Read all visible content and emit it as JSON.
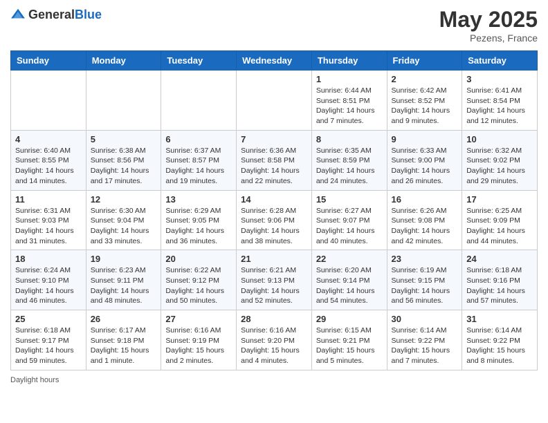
{
  "header": {
    "logo_general": "General",
    "logo_blue": "Blue",
    "month_title": "May 2025",
    "location": "Pezens, France"
  },
  "weekdays": [
    "Sunday",
    "Monday",
    "Tuesday",
    "Wednesday",
    "Thursday",
    "Friday",
    "Saturday"
  ],
  "legend": {
    "daylight_label": "Daylight hours"
  },
  "weeks": [
    [
      {
        "day": "",
        "sunrise": "",
        "sunset": "",
        "daylight": ""
      },
      {
        "day": "",
        "sunrise": "",
        "sunset": "",
        "daylight": ""
      },
      {
        "day": "",
        "sunrise": "",
        "sunset": "",
        "daylight": ""
      },
      {
        "day": "",
        "sunrise": "",
        "sunset": "",
        "daylight": ""
      },
      {
        "day": "1",
        "sunrise": "6:44 AM",
        "sunset": "8:51 PM",
        "daylight": "14 hours and 7 minutes."
      },
      {
        "day": "2",
        "sunrise": "6:42 AM",
        "sunset": "8:52 PM",
        "daylight": "14 hours and 9 minutes."
      },
      {
        "day": "3",
        "sunrise": "6:41 AM",
        "sunset": "8:54 PM",
        "daylight": "14 hours and 12 minutes."
      }
    ],
    [
      {
        "day": "4",
        "sunrise": "6:40 AM",
        "sunset": "8:55 PM",
        "daylight": "14 hours and 14 minutes."
      },
      {
        "day": "5",
        "sunrise": "6:38 AM",
        "sunset": "8:56 PM",
        "daylight": "14 hours and 17 minutes."
      },
      {
        "day": "6",
        "sunrise": "6:37 AM",
        "sunset": "8:57 PM",
        "daylight": "14 hours and 19 minutes."
      },
      {
        "day": "7",
        "sunrise": "6:36 AM",
        "sunset": "8:58 PM",
        "daylight": "14 hours and 22 minutes."
      },
      {
        "day": "8",
        "sunrise": "6:35 AM",
        "sunset": "8:59 PM",
        "daylight": "14 hours and 24 minutes."
      },
      {
        "day": "9",
        "sunrise": "6:33 AM",
        "sunset": "9:00 PM",
        "daylight": "14 hours and 26 minutes."
      },
      {
        "day": "10",
        "sunrise": "6:32 AM",
        "sunset": "9:02 PM",
        "daylight": "14 hours and 29 minutes."
      }
    ],
    [
      {
        "day": "11",
        "sunrise": "6:31 AM",
        "sunset": "9:03 PM",
        "daylight": "14 hours and 31 minutes."
      },
      {
        "day": "12",
        "sunrise": "6:30 AM",
        "sunset": "9:04 PM",
        "daylight": "14 hours and 33 minutes."
      },
      {
        "day": "13",
        "sunrise": "6:29 AM",
        "sunset": "9:05 PM",
        "daylight": "14 hours and 36 minutes."
      },
      {
        "day": "14",
        "sunrise": "6:28 AM",
        "sunset": "9:06 PM",
        "daylight": "14 hours and 38 minutes."
      },
      {
        "day": "15",
        "sunrise": "6:27 AM",
        "sunset": "9:07 PM",
        "daylight": "14 hours and 40 minutes."
      },
      {
        "day": "16",
        "sunrise": "6:26 AM",
        "sunset": "9:08 PM",
        "daylight": "14 hours and 42 minutes."
      },
      {
        "day": "17",
        "sunrise": "6:25 AM",
        "sunset": "9:09 PM",
        "daylight": "14 hours and 44 minutes."
      }
    ],
    [
      {
        "day": "18",
        "sunrise": "6:24 AM",
        "sunset": "9:10 PM",
        "daylight": "14 hours and 46 minutes."
      },
      {
        "day": "19",
        "sunrise": "6:23 AM",
        "sunset": "9:11 PM",
        "daylight": "14 hours and 48 minutes."
      },
      {
        "day": "20",
        "sunrise": "6:22 AM",
        "sunset": "9:12 PM",
        "daylight": "14 hours and 50 minutes."
      },
      {
        "day": "21",
        "sunrise": "6:21 AM",
        "sunset": "9:13 PM",
        "daylight": "14 hours and 52 minutes."
      },
      {
        "day": "22",
        "sunrise": "6:20 AM",
        "sunset": "9:14 PM",
        "daylight": "14 hours and 54 minutes."
      },
      {
        "day": "23",
        "sunrise": "6:19 AM",
        "sunset": "9:15 PM",
        "daylight": "14 hours and 56 minutes."
      },
      {
        "day": "24",
        "sunrise": "6:18 AM",
        "sunset": "9:16 PM",
        "daylight": "14 hours and 57 minutes."
      }
    ],
    [
      {
        "day": "25",
        "sunrise": "6:18 AM",
        "sunset": "9:17 PM",
        "daylight": "14 hours and 59 minutes."
      },
      {
        "day": "26",
        "sunrise": "6:17 AM",
        "sunset": "9:18 PM",
        "daylight": "15 hours and 1 minute."
      },
      {
        "day": "27",
        "sunrise": "6:16 AM",
        "sunset": "9:19 PM",
        "daylight": "15 hours and 2 minutes."
      },
      {
        "day": "28",
        "sunrise": "6:16 AM",
        "sunset": "9:20 PM",
        "daylight": "15 hours and 4 minutes."
      },
      {
        "day": "29",
        "sunrise": "6:15 AM",
        "sunset": "9:21 PM",
        "daylight": "15 hours and 5 minutes."
      },
      {
        "day": "30",
        "sunrise": "6:14 AM",
        "sunset": "9:22 PM",
        "daylight": "15 hours and 7 minutes."
      },
      {
        "day": "31",
        "sunrise": "6:14 AM",
        "sunset": "9:22 PM",
        "daylight": "15 hours and 8 minutes."
      }
    ]
  ]
}
